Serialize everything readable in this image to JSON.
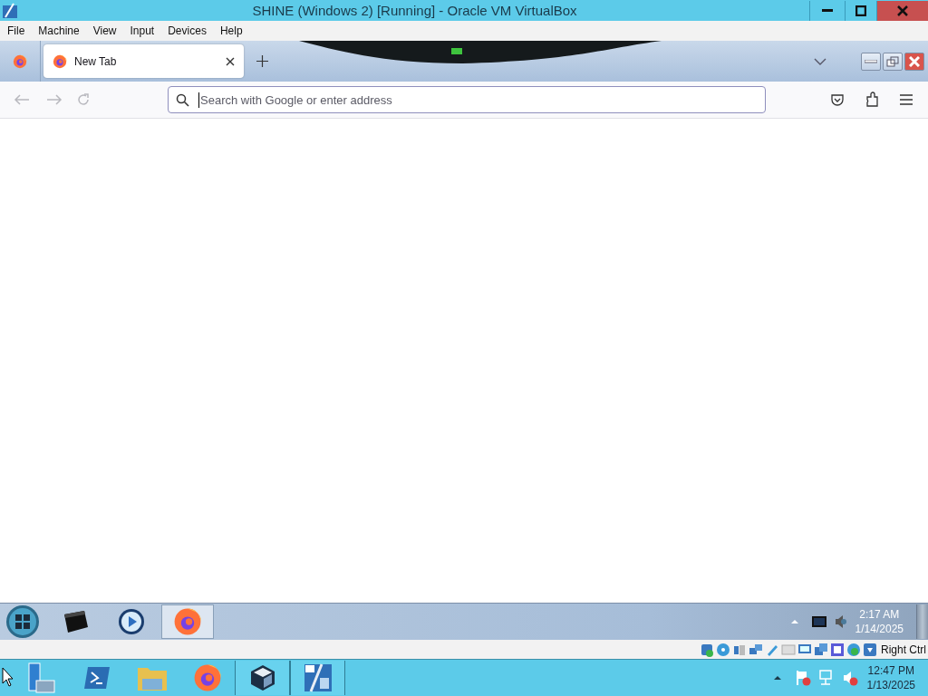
{
  "window": {
    "title": "SHINE (Windows 2) [Running] - Oracle VM VirtualBox"
  },
  "menu": {
    "items": [
      "File",
      "Machine",
      "View",
      "Input",
      "Devices",
      "Help"
    ]
  },
  "browser": {
    "tabs": [
      {
        "label": "New Tab",
        "selected": true
      }
    ],
    "address_bar": {
      "placeholder": "Search with Google or enter address"
    }
  },
  "guest_taskbar": {
    "apps": [
      {
        "kind": "start"
      },
      {
        "kind": "box",
        "selected": false
      },
      {
        "kind": "media",
        "selected": false
      },
      {
        "kind": "firefox",
        "selected": true
      }
    ],
    "clock": {
      "time": "2:17 AM",
      "date": "1/14/2025"
    }
  },
  "status_bar": {
    "host_key": "Right Ctrl"
  },
  "host_taskbar": {
    "apps": [
      {
        "kind": "server",
        "running": false
      },
      {
        "kind": "shell",
        "running": false
      },
      {
        "kind": "folder",
        "running": false
      },
      {
        "kind": "firefox",
        "running": false
      },
      {
        "kind": "virtualbox",
        "running": true
      },
      {
        "kind": "vm",
        "running": true
      }
    ],
    "clock": {
      "time": "12:47 PM",
      "date": "1/13/2025"
    }
  }
}
